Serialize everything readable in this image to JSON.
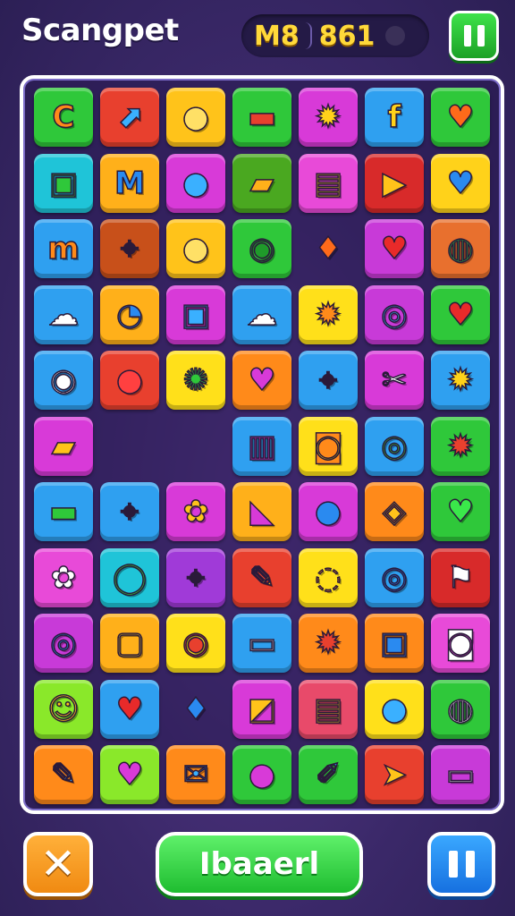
{
  "header": {
    "title": "Scangpet",
    "score_left": "M8",
    "score_right": "861",
    "pause_icon": "pause-icon"
  },
  "footer": {
    "close_icon": "close-icon",
    "main_button_label": "Ibaaerl",
    "pause_icon": "pause-icon"
  },
  "board": {
    "rows": [
      [
        {
          "bg": "#2fc83a",
          "g": "C",
          "c": "#ff8a1a",
          "icon": "letter-c-icon"
        },
        {
          "bg": "#e8402e",
          "g": "⬈",
          "c": "#3ab0ff",
          "icon": "pointer-arrow-icon"
        },
        {
          "bg": "#ffc31a",
          "g": "●",
          "c": "#ffe066",
          "icon": "lemon-icon"
        },
        {
          "bg": "#2fc83a",
          "g": "▬",
          "c": "#e8402e",
          "icon": "basket-icon"
        },
        {
          "bg": "#d83ad8",
          "g": "✹",
          "c": "#ffd21a",
          "icon": "gear-icon"
        },
        {
          "bg": "#2fa0f0",
          "g": "f",
          "c": "#ffd21a",
          "icon": "letter-f-icon"
        },
        {
          "bg": "#2fc83a",
          "g": "♥",
          "c": "#ff6a1a",
          "icon": "fire-heart-icon"
        }
      ],
      [
        {
          "bg": "#1fc4d8",
          "g": "▣",
          "c": "#2fc83a",
          "icon": "briefcase-icon"
        },
        {
          "bg": "#ffb01a",
          "g": "M",
          "c": "#2a8af0",
          "icon": "letter-m-icon"
        },
        {
          "bg": "#d83ad8",
          "g": "●",
          "c": "#3ab0ff",
          "icon": "search-icon"
        },
        {
          "bg": "#4aa820",
          "g": "▰",
          "c": "#ffb01a",
          "icon": "chat-icon"
        },
        {
          "bg": "#e84ad8",
          "g": "▤",
          "c": "#ffd21a",
          "icon": "clipboard-icon"
        },
        {
          "bg": "#d82a2a",
          "g": "▶",
          "c": "#ffc31a",
          "icon": "play-icon"
        },
        {
          "bg": "#ffd21a",
          "g": "♥",
          "c": "#2a8af0",
          "icon": "heart-icon"
        }
      ],
      [
        {
          "bg": "#2fa0f0",
          "g": "m",
          "c": "#ff8a1a",
          "icon": "bridge-icon"
        },
        {
          "bg": "#c8501a",
          "g": "⌖",
          "c": "#3ab0ff",
          "icon": "location-pin-icon"
        },
        {
          "bg": "#ffc31a",
          "g": "●",
          "c": "#ffe066",
          "icon": "speech-bubble-icon"
        },
        {
          "bg": "#2fc83a",
          "g": "◉",
          "c": "#1f9a2a",
          "icon": "message-circle-icon"
        },
        {
          "bg": "empty",
          "g": "♦",
          "c": "#ff6a1a",
          "icon": "flame-drop-icon"
        },
        {
          "bg": "#c83ad8",
          "g": "♥",
          "c": "#e82a2a",
          "icon": "heart-icon"
        },
        {
          "bg": "#e8702e",
          "g": "◍",
          "c": "#2fc83a",
          "icon": "leaf-icon"
        }
      ],
      [
        {
          "bg": "#2fa0f0",
          "g": "☁",
          "c": "#ffffff",
          "icon": "cloud-chat-icon"
        },
        {
          "bg": "#ffb01a",
          "g": "◔",
          "c": "#2a8af0",
          "icon": "clock-icon"
        },
        {
          "bg": "#d83ad8",
          "g": "▣",
          "c": "#3ab0ff",
          "icon": "bag-icon"
        },
        {
          "bg": "#2fa0f0",
          "g": "☁",
          "c": "#ffffff",
          "icon": "cloud-icon"
        },
        {
          "bg": "#ffe01a",
          "g": "✹",
          "c": "#ff8a1a",
          "icon": "gear-icon"
        },
        {
          "bg": "#c83ad8",
          "g": "◎",
          "c": "#3ab0ff",
          "icon": "chat-bubble-icon"
        },
        {
          "bg": "#2fc83a",
          "g": "♥",
          "c": "#e82a2a",
          "icon": "heart-icon"
        }
      ],
      [
        {
          "bg": "#2fa0f0",
          "g": "◉",
          "c": "#ffffff",
          "icon": "speech-bubble-icon"
        },
        {
          "bg": "#e8402e",
          "g": "●",
          "c": "#ff4040",
          "icon": "apple-icon"
        },
        {
          "bg": "#ffe01a",
          "g": "✺",
          "c": "#2fc83a",
          "icon": "gear-icon"
        },
        {
          "bg": "#ff8a1a",
          "g": "♥",
          "c": "#d83ad8",
          "icon": "heart-icon"
        },
        {
          "bg": "#2fa0f0",
          "g": "⌖",
          "c": "#d83ad8",
          "icon": "location-pin-icon"
        },
        {
          "bg": "#d83ad8",
          "g": "✂",
          "c": "#ffffff",
          "icon": "wrench-icon"
        },
        {
          "bg": "#2fa0f0",
          "g": "✹",
          "c": "#ffd21a",
          "icon": "gear-icon"
        }
      ],
      [
        {
          "bg": "#d83ad8",
          "g": "▰",
          "c": "#ffc31a",
          "icon": "ticket-icon"
        },
        {
          "bg": "empty",
          "g": "",
          "c": "",
          "icon": "empty-slot"
        },
        {
          "bg": "empty",
          "g": "",
          "c": "",
          "icon": "empty-slot"
        },
        {
          "bg": "#2fa0f0",
          "g": "▥",
          "c": "#d83ad8",
          "icon": "folder-icon"
        },
        {
          "bg": "#ffe01a",
          "g": "◙",
          "c": "#ff8a1a",
          "icon": "camera-icon"
        },
        {
          "bg": "#2fa0f0",
          "g": "◎",
          "c": "#2fc83a",
          "icon": "target-icon"
        },
        {
          "bg": "#2fc83a",
          "g": "✹",
          "c": "#e8402e",
          "icon": "gear-icon"
        }
      ],
      [
        {
          "bg": "#2fa0f0",
          "g": "▬",
          "c": "#2fc83a",
          "icon": "basket-icon"
        },
        {
          "bg": "#2fa0f0",
          "g": "⌖",
          "c": "#ffffff",
          "icon": "location-pin-icon"
        },
        {
          "bg": "#d83ad8",
          "g": "✿",
          "c": "#ffc31a",
          "icon": "flower-icon"
        },
        {
          "bg": "#ffb01a",
          "g": "◣",
          "c": "#d83ad8",
          "icon": "chart-icon"
        },
        {
          "bg": "#d83ad8",
          "g": "●",
          "c": "#2a8af0",
          "icon": "bird-icon"
        },
        {
          "bg": "#ff8a1a",
          "g": "◈",
          "c": "#ffc31a",
          "icon": "football-icon"
        },
        {
          "bg": "#2fc83a",
          "g": "♥",
          "c": "#3ae84a",
          "icon": "heart-icon"
        }
      ],
      [
        {
          "bg": "#e84ad8",
          "g": "✿",
          "c": "#ffffff",
          "icon": "pretzel-icon"
        },
        {
          "bg": "#1fc4d8",
          "g": "◯",
          "c": "#2fc83a",
          "icon": "search-icon"
        },
        {
          "bg": "#a03ad8",
          "g": "⌖",
          "c": "#3ab0ff",
          "icon": "location-pin-icon"
        },
        {
          "bg": "#e8402e",
          "g": "✎",
          "c": "#ffc31a",
          "icon": "pencil-icon"
        },
        {
          "bg": "#ffe01a",
          "g": "◌",
          "c": "#ff8a1a",
          "icon": "donut-icon"
        },
        {
          "bg": "#2fa0f0",
          "g": "◎",
          "c": "#1f70e0",
          "icon": "badge-icon"
        },
        {
          "bg": "#d82a2a",
          "g": "⚑",
          "c": "#ffffff",
          "icon": "flag-icon"
        }
      ],
      [
        {
          "bg": "#c83ad8",
          "g": "◎",
          "c": "#2a8af0",
          "icon": "search-icon"
        },
        {
          "bg": "#ffb01a",
          "g": "▢",
          "c": "#ffd21a",
          "icon": "document-icon"
        },
        {
          "bg": "#ffe01a",
          "g": "◉",
          "c": "#e8402e",
          "icon": "target-icon"
        },
        {
          "bg": "#2fa0f0",
          "g": "▭",
          "c": "#ffffff",
          "icon": "briefcase-icon"
        },
        {
          "bg": "#ff8a1a",
          "g": "✹",
          "c": "#e8402e",
          "icon": "gear-icon"
        },
        {
          "bg": "#ff8a1a",
          "g": "▣",
          "c": "#2a8af0",
          "icon": "bag-icon"
        },
        {
          "bg": "#e84ad8",
          "g": "◙",
          "c": "#ffffff",
          "icon": "camera-icon"
        }
      ],
      [
        {
          "bg": "#8ae82a",
          "g": "☺",
          "c": "#ffc31a",
          "icon": "smiley-icon"
        },
        {
          "bg": "#2fa0f0",
          "g": "♥",
          "c": "#e82a2a",
          "icon": "heart-icon"
        },
        {
          "bg": "empty",
          "g": "♦",
          "c": "#2a8af0",
          "icon": "water-drop-icon"
        },
        {
          "bg": "#d83ad8",
          "g": "◩",
          "c": "#ffc31a",
          "icon": "clipboard-icon"
        },
        {
          "bg": "#e84a6a",
          "g": "▤",
          "c": "#ffc31a",
          "icon": "list-icon"
        },
        {
          "bg": "#ffe01a",
          "g": "●",
          "c": "#3ab0ff",
          "icon": "speech-bubble-icon"
        },
        {
          "bg": "#2fc83a",
          "g": "◍",
          "c": "#ffffff",
          "icon": "chat-bubble-icon"
        }
      ],
      [
        {
          "bg": "#ff8a1a",
          "g": "✎",
          "c": "#3ab0ff",
          "icon": "pen-icon"
        },
        {
          "bg": "#8ae82a",
          "g": "♥",
          "c": "#d83ad8",
          "icon": "heart-icon"
        },
        {
          "bg": "#ff8a1a",
          "g": "✉",
          "c": "#3ab0ff",
          "icon": "envelope-icon"
        },
        {
          "bg": "#2fc83a",
          "g": "●",
          "c": "#d83ad8",
          "icon": "grape-icon"
        },
        {
          "bg": "#2fc83a",
          "g": "✐",
          "c": "#2a8af0",
          "icon": "brush-icon"
        },
        {
          "bg": "#e8402e",
          "g": "➤",
          "c": "#ffc31a",
          "icon": "send-icon"
        },
        {
          "bg": "#c83ad8",
          "g": "▭",
          "c": "#ffffff",
          "icon": "monitor-icon"
        }
      ]
    ]
  }
}
